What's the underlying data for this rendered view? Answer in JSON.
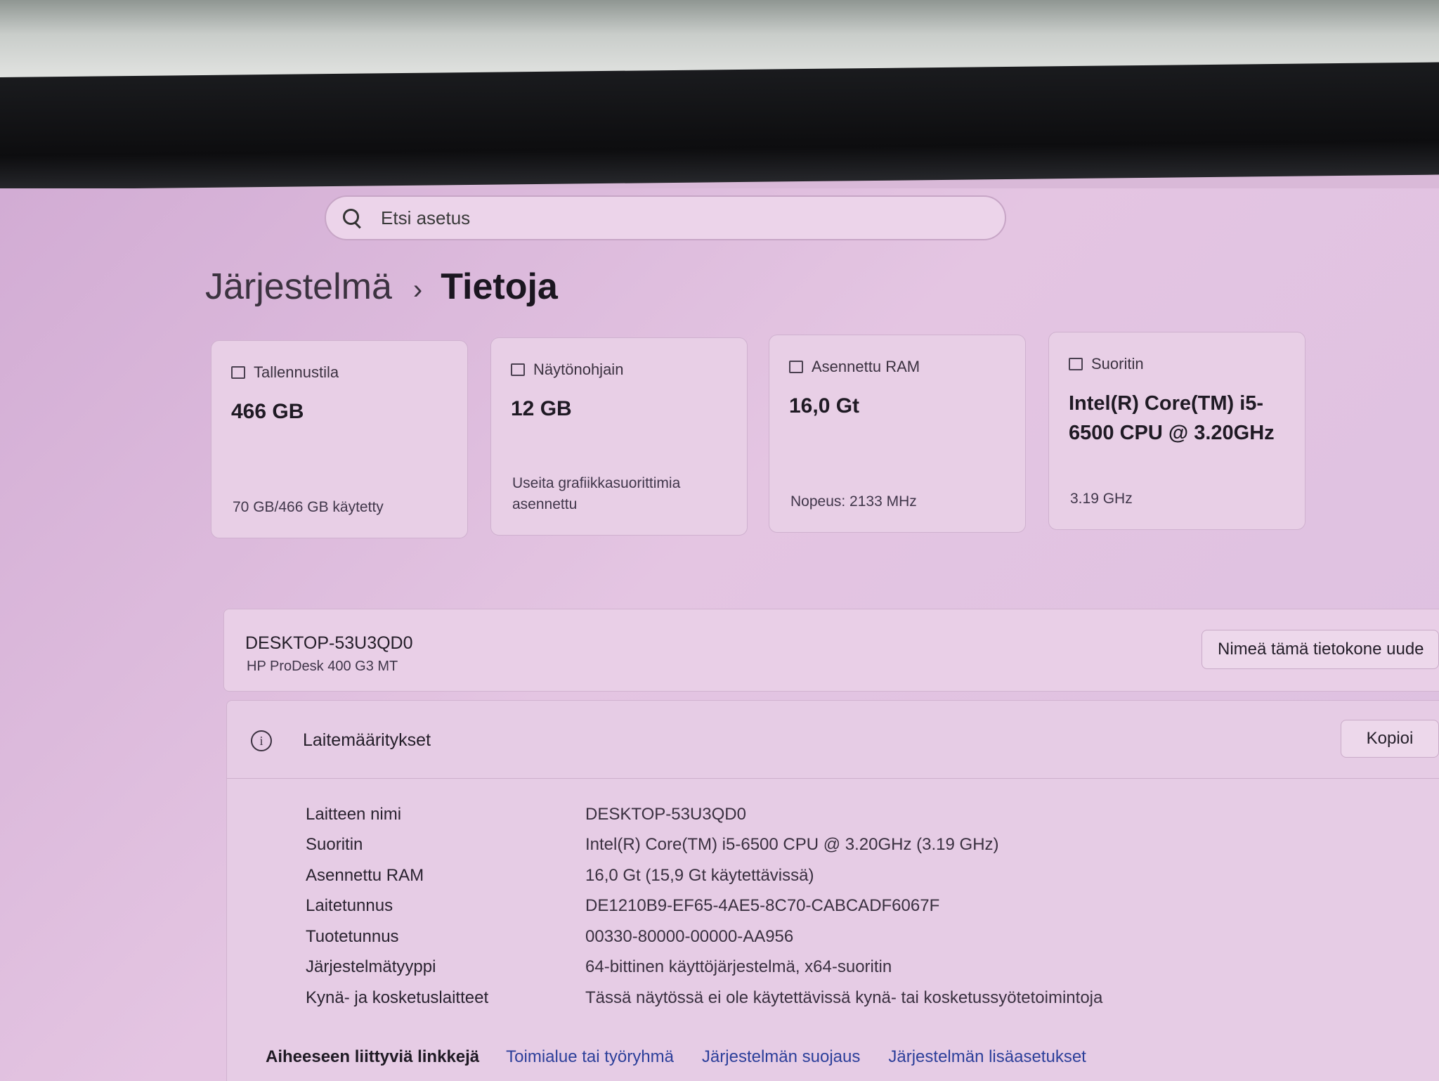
{
  "search": {
    "placeholder": "Etsi asetus"
  },
  "breadcrumb": {
    "parent": "Järjestelmä",
    "separator": "›",
    "current": "Tietoja"
  },
  "cards": [
    {
      "title": "Tallennustila",
      "value": "466 GB",
      "footer": "70 GB/466 GB käytetty",
      "icon": "storage-icon"
    },
    {
      "title": "Näytönohjain",
      "value": "12 GB",
      "footer": "Useita grafiikkasuorittimia asennettu",
      "icon": "display-adapter-icon"
    },
    {
      "title": "Asennettu RAM",
      "value": "16,0 Gt",
      "footer": "Nopeus: 2133 MHz",
      "icon": "ram-icon"
    },
    {
      "title": "Suoritin",
      "value": "Intel(R) Core(TM) i5-6500 CPU @ 3.20GHz",
      "footer": "3.19 GHz",
      "icon": "processor-icon"
    }
  ],
  "device": {
    "name": "DESKTOP-53U3QD0",
    "model": "HP ProDesk 400 G3 MT",
    "rename_button": "Nimeä tämä tietokone uude"
  },
  "specs": {
    "title": "Laitemääritykset",
    "copy_button": "Kopioi",
    "rows": [
      {
        "key": "Laitteen nimi",
        "value": "DESKTOP-53U3QD0"
      },
      {
        "key": "Suoritin",
        "value": "Intel(R) Core(TM) i5-6500 CPU @ 3.20GHz (3.19 GHz)"
      },
      {
        "key": "Asennettu RAM",
        "value": "16,0 Gt (15,9 Gt käytettävissä)"
      },
      {
        "key": "Laitetunnus",
        "value": "DE1210B9-EF65-4AE5-8C70-CABCADF6067F"
      },
      {
        "key": "Tuotetunnus",
        "value": "00330-80000-00000-AA956"
      },
      {
        "key": "Järjestelmätyyppi",
        "value": "64-bittinen käyttöjärjestelmä, x64-suoritin"
      },
      {
        "key": "Kynä- ja kosketuslaitteet",
        "value": "Tässä näytössä ei ole käytettävissä kynä- tai kosketussyötetoimintoja"
      }
    ]
  },
  "related_links": {
    "label": "Aiheeseen liittyviä linkkejä",
    "items": [
      "Toimialue tai työryhmä",
      "Järjestelmän suojaus",
      "Järjestelmän lisäasetukset"
    ]
  }
}
